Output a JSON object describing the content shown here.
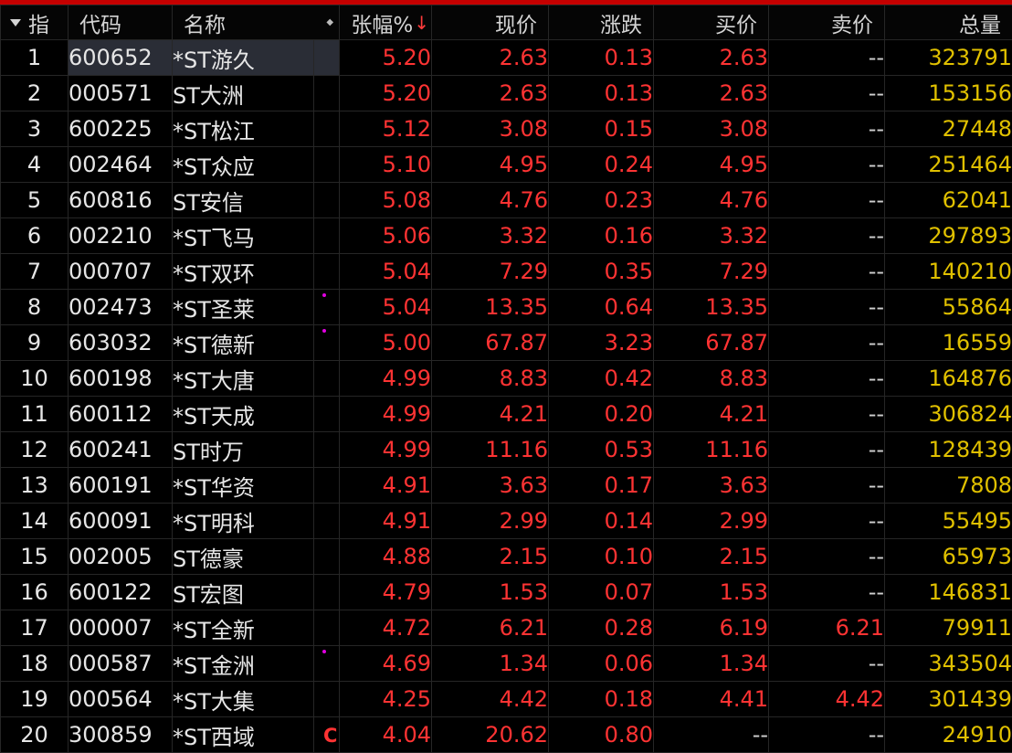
{
  "header": {
    "idx": "指",
    "code": "代码",
    "name": "名称",
    "pct": "张幅%",
    "price": "现价",
    "change": "涨跌",
    "bid": "买价",
    "ask": "卖价",
    "volume": "总量"
  },
  "colors": {
    "up": "#ff3333",
    "volume": "#e0c000",
    "text": "#e6e6e6",
    "accent_bar": "#c40000",
    "mark_dot": "#e000e0"
  },
  "rows": [
    {
      "idx": "1",
      "code": "600652",
      "name": "*ST游久",
      "mark": "",
      "pct": "5.20",
      "price": "2.63",
      "change": "0.13",
      "bid": "2.63",
      "ask": "--",
      "volume": "323791"
    },
    {
      "idx": "2",
      "code": "000571",
      "name": "ST大洲",
      "mark": "",
      "pct": "5.20",
      "price": "2.63",
      "change": "0.13",
      "bid": "2.63",
      "ask": "--",
      "volume": "153156"
    },
    {
      "idx": "3",
      "code": "600225",
      "name": "*ST松江",
      "mark": "",
      "pct": "5.12",
      "price": "3.08",
      "change": "0.15",
      "bid": "3.08",
      "ask": "--",
      "volume": "27448"
    },
    {
      "idx": "4",
      "code": "002464",
      "name": "*ST众应",
      "mark": "",
      "pct": "5.10",
      "price": "4.95",
      "change": "0.24",
      "bid": "4.95",
      "ask": "--",
      "volume": "251464"
    },
    {
      "idx": "5",
      "code": "600816",
      "name": "ST安信",
      "mark": "",
      "pct": "5.08",
      "price": "4.76",
      "change": "0.23",
      "bid": "4.76",
      "ask": "--",
      "volume": "62041"
    },
    {
      "idx": "6",
      "code": "002210",
      "name": "*ST飞马",
      "mark": "",
      "pct": "5.06",
      "price": "3.32",
      "change": "0.16",
      "bid": "3.32",
      "ask": "--",
      "volume": "297893"
    },
    {
      "idx": "7",
      "code": "000707",
      "name": "*ST双环",
      "mark": "",
      "pct": "5.04",
      "price": "7.29",
      "change": "0.35",
      "bid": "7.29",
      "ask": "--",
      "volume": "140210"
    },
    {
      "idx": "8",
      "code": "002473",
      "name": "*ST圣莱",
      "mark": "dot",
      "pct": "5.04",
      "price": "13.35",
      "change": "0.64",
      "bid": "13.35",
      "ask": "--",
      "volume": "55864"
    },
    {
      "idx": "9",
      "code": "603032",
      "name": "*ST德新",
      "mark": "dot",
      "pct": "5.00",
      "price": "67.87",
      "change": "3.23",
      "bid": "67.87",
      "ask": "--",
      "volume": "16559"
    },
    {
      "idx": "10",
      "code": "600198",
      "name": "*ST大唐",
      "mark": "",
      "pct": "4.99",
      "price": "8.83",
      "change": "0.42",
      "bid": "8.83",
      "ask": "--",
      "volume": "164876"
    },
    {
      "idx": "11",
      "code": "600112",
      "name": "*ST天成",
      "mark": "",
      "pct": "4.99",
      "price": "4.21",
      "change": "0.20",
      "bid": "4.21",
      "ask": "--",
      "volume": "306824"
    },
    {
      "idx": "12",
      "code": "600241",
      "name": "ST时万",
      "mark": "",
      "pct": "4.99",
      "price": "11.16",
      "change": "0.53",
      "bid": "11.16",
      "ask": "--",
      "volume": "128439"
    },
    {
      "idx": "13",
      "code": "600191",
      "name": "*ST华资",
      "mark": "",
      "pct": "4.91",
      "price": "3.63",
      "change": "0.17",
      "bid": "3.63",
      "ask": "--",
      "volume": "7808"
    },
    {
      "idx": "14",
      "code": "600091",
      "name": "*ST明科",
      "mark": "",
      "pct": "4.91",
      "price": "2.99",
      "change": "0.14",
      "bid": "2.99",
      "ask": "--",
      "volume": "55495"
    },
    {
      "idx": "15",
      "code": "002005",
      "name": "ST德豪",
      "mark": "",
      "pct": "4.88",
      "price": "2.15",
      "change": "0.10",
      "bid": "2.15",
      "ask": "--",
      "volume": "65973"
    },
    {
      "idx": "16",
      "code": "600122",
      "name": "ST宏图",
      "mark": "",
      "pct": "4.79",
      "price": "1.53",
      "change": "0.07",
      "bid": "1.53",
      "ask": "--",
      "volume": "146831"
    },
    {
      "idx": "17",
      "code": "000007",
      "name": "*ST全新",
      "mark": "",
      "pct": "4.72",
      "price": "6.21",
      "change": "0.28",
      "bid": "6.19",
      "ask": "6.21",
      "volume": "79911"
    },
    {
      "idx": "18",
      "code": "000587",
      "name": "*ST金洲",
      "mark": "dot",
      "pct": "4.69",
      "price": "1.34",
      "change": "0.06",
      "bid": "1.34",
      "ask": "--",
      "volume": "343504"
    },
    {
      "idx": "19",
      "code": "000564",
      "name": "*ST大集",
      "mark": "",
      "pct": "4.25",
      "price": "4.42",
      "change": "0.18",
      "bid": "4.41",
      "ask": "4.42",
      "volume": "301439"
    },
    {
      "idx": "20",
      "code": "300859",
      "name": "*ST西域",
      "mark": "C",
      "pct": "4.04",
      "price": "20.62",
      "change": "0.80",
      "bid": "--",
      "ask": "--",
      "volume": "24910"
    }
  ]
}
